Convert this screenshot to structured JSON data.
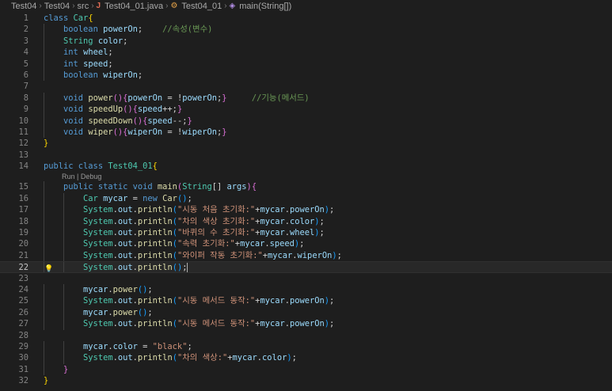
{
  "breadcrumb": {
    "items": [
      "Test04",
      "Test04",
      "src",
      "Test04_01.java",
      "Test04_01",
      "main(String[])"
    ],
    "icons": [
      "java-file-icon",
      "class-icon",
      "method-icon"
    ]
  },
  "editor": {
    "current_line": 22,
    "codelens": "Run | Debug",
    "lines": [
      {
        "n": "1",
        "tokens": [
          [
            "kw",
            "class "
          ],
          [
            "ty",
            "Car"
          ],
          [
            "br1",
            "{"
          ]
        ]
      },
      {
        "n": "2",
        "tokens": [
          [
            "pl",
            "    "
          ],
          [
            "kw",
            "boolean "
          ],
          [
            "va",
            "powerOn"
          ],
          [
            "pl",
            ";    "
          ],
          [
            "cm",
            "//속성(변수)"
          ]
        ]
      },
      {
        "n": "3",
        "tokens": [
          [
            "pl",
            "    "
          ],
          [
            "ty",
            "String "
          ],
          [
            "va",
            "color"
          ],
          [
            "pl",
            ";"
          ]
        ]
      },
      {
        "n": "4",
        "tokens": [
          [
            "pl",
            "    "
          ],
          [
            "kw",
            "int "
          ],
          [
            "va",
            "wheel"
          ],
          [
            "pl",
            ";"
          ]
        ]
      },
      {
        "n": "5",
        "tokens": [
          [
            "pl",
            "    "
          ],
          [
            "kw",
            "int "
          ],
          [
            "va",
            "speed"
          ],
          [
            "pl",
            ";"
          ]
        ]
      },
      {
        "n": "6",
        "tokens": [
          [
            "pl",
            "    "
          ],
          [
            "kw",
            "boolean "
          ],
          [
            "va",
            "wiperOn"
          ],
          [
            "pl",
            ";"
          ]
        ]
      },
      {
        "n": "7",
        "tokens": []
      },
      {
        "n": "8",
        "tokens": [
          [
            "pl",
            "    "
          ],
          [
            "kw",
            "void "
          ],
          [
            "fn",
            "power"
          ],
          [
            "br2",
            "()"
          ],
          [
            "br2",
            "{"
          ],
          [
            "va",
            "powerOn"
          ],
          [
            "pl",
            " = !"
          ],
          [
            "va",
            "powerOn"
          ],
          [
            "pl",
            ";"
          ],
          [
            "br2",
            "}"
          ],
          [
            "pl",
            "     "
          ],
          [
            "cm",
            "//기능(메서드)"
          ]
        ]
      },
      {
        "n": "9",
        "tokens": [
          [
            "pl",
            "    "
          ],
          [
            "kw",
            "void "
          ],
          [
            "fn",
            "speedUp"
          ],
          [
            "br2",
            "()"
          ],
          [
            "br2",
            "{"
          ],
          [
            "va",
            "speed"
          ],
          [
            "pl",
            "++;"
          ],
          [
            "br2",
            "}"
          ]
        ]
      },
      {
        "n": "10",
        "tokens": [
          [
            "pl",
            "    "
          ],
          [
            "kw",
            "void "
          ],
          [
            "fn",
            "speedDown"
          ],
          [
            "br2",
            "()"
          ],
          [
            "br2",
            "{"
          ],
          [
            "va",
            "speed"
          ],
          [
            "pl",
            "--;"
          ],
          [
            "br2",
            "}"
          ]
        ]
      },
      {
        "n": "11",
        "tokens": [
          [
            "pl",
            "    "
          ],
          [
            "kw",
            "void "
          ],
          [
            "fn",
            "wiper"
          ],
          [
            "br2",
            "()"
          ],
          [
            "br2",
            "{"
          ],
          [
            "va",
            "wiperOn"
          ],
          [
            "pl",
            " = !"
          ],
          [
            "va",
            "wiperOn"
          ],
          [
            "pl",
            ";"
          ],
          [
            "br2",
            "}"
          ]
        ]
      },
      {
        "n": "12",
        "tokens": [
          [
            "br1",
            "}"
          ]
        ]
      },
      {
        "n": "13",
        "tokens": []
      },
      {
        "n": "14",
        "tokens": [
          [
            "kw",
            "public class "
          ],
          [
            "ty",
            "Test04_01"
          ],
          [
            "br1",
            "{"
          ]
        ]
      },
      {
        "n": "15",
        "lens": true,
        "tokens": [
          [
            "pl",
            "    "
          ],
          [
            "kw",
            "public static void "
          ],
          [
            "fn",
            "main"
          ],
          [
            "br2",
            "("
          ],
          [
            "ty",
            "String"
          ],
          [
            "pl",
            "[] "
          ],
          [
            "va",
            "args"
          ],
          [
            "br2",
            ")"
          ],
          [
            "br2",
            "{"
          ]
        ]
      },
      {
        "n": "16",
        "tokens": [
          [
            "pl",
            "        "
          ],
          [
            "ty",
            "Car "
          ],
          [
            "va",
            "mycar"
          ],
          [
            "pl",
            " = "
          ],
          [
            "kw",
            "new "
          ],
          [
            "fn",
            "Car"
          ],
          [
            "br3",
            "()"
          ],
          [
            "pl",
            ";"
          ]
        ]
      },
      {
        "n": "17",
        "tokens": [
          [
            "pl",
            "        "
          ],
          [
            "ty",
            "System"
          ],
          [
            "pl",
            "."
          ],
          [
            "va",
            "out"
          ],
          [
            "pl",
            "."
          ],
          [
            "fn",
            "println"
          ],
          [
            "br3",
            "("
          ],
          [
            "st",
            "\"시동 처음 초기화:\""
          ],
          [
            "pl",
            "+"
          ],
          [
            "va",
            "mycar"
          ],
          [
            "pl",
            "."
          ],
          [
            "va",
            "powerOn"
          ],
          [
            "br3",
            ")"
          ],
          [
            "pl",
            ";"
          ]
        ]
      },
      {
        "n": "18",
        "tokens": [
          [
            "pl",
            "        "
          ],
          [
            "ty",
            "System"
          ],
          [
            "pl",
            "."
          ],
          [
            "va",
            "out"
          ],
          [
            "pl",
            "."
          ],
          [
            "fn",
            "println"
          ],
          [
            "br3",
            "("
          ],
          [
            "st",
            "\"차의 색상 초기화:\""
          ],
          [
            "pl",
            "+"
          ],
          [
            "va",
            "mycar"
          ],
          [
            "pl",
            "."
          ],
          [
            "va",
            "color"
          ],
          [
            "br3",
            ")"
          ],
          [
            "pl",
            ";"
          ]
        ]
      },
      {
        "n": "19",
        "tokens": [
          [
            "pl",
            "        "
          ],
          [
            "ty",
            "System"
          ],
          [
            "pl",
            "."
          ],
          [
            "va",
            "out"
          ],
          [
            "pl",
            "."
          ],
          [
            "fn",
            "println"
          ],
          [
            "br3",
            "("
          ],
          [
            "st",
            "\"바퀴의 수 초기화:\""
          ],
          [
            "pl",
            "+"
          ],
          [
            "va",
            "mycar"
          ],
          [
            "pl",
            "."
          ],
          [
            "va",
            "wheel"
          ],
          [
            "br3",
            ")"
          ],
          [
            "pl",
            ";"
          ]
        ]
      },
      {
        "n": "20",
        "tokens": [
          [
            "pl",
            "        "
          ],
          [
            "ty",
            "System"
          ],
          [
            "pl",
            "."
          ],
          [
            "va",
            "out"
          ],
          [
            "pl",
            "."
          ],
          [
            "fn",
            "println"
          ],
          [
            "br3",
            "("
          ],
          [
            "st",
            "\"속력 초기화:\""
          ],
          [
            "pl",
            "+"
          ],
          [
            "va",
            "mycar"
          ],
          [
            "pl",
            "."
          ],
          [
            "va",
            "speed"
          ],
          [
            "br3",
            ")"
          ],
          [
            "pl",
            ";"
          ]
        ]
      },
      {
        "n": "21",
        "tokens": [
          [
            "pl",
            "        "
          ],
          [
            "ty",
            "System"
          ],
          [
            "pl",
            "."
          ],
          [
            "va",
            "out"
          ],
          [
            "pl",
            "."
          ],
          [
            "fn",
            "println"
          ],
          [
            "br3",
            "("
          ],
          [
            "st",
            "\"와이퍼 작동 초기화:\""
          ],
          [
            "pl",
            "+"
          ],
          [
            "va",
            "mycar"
          ],
          [
            "pl",
            "."
          ],
          [
            "va",
            "wiperOn"
          ],
          [
            "br3",
            ")"
          ],
          [
            "pl",
            ";"
          ]
        ]
      },
      {
        "n": "22",
        "bulb": true,
        "caret": true,
        "tokens": [
          [
            "pl",
            "        "
          ],
          [
            "ty",
            "System"
          ],
          [
            "pl",
            "."
          ],
          [
            "va",
            "out"
          ],
          [
            "pl",
            "."
          ],
          [
            "fn",
            "println"
          ],
          [
            "br3",
            "()"
          ],
          [
            "pl",
            ";"
          ]
        ]
      },
      {
        "n": "23",
        "tokens": []
      },
      {
        "n": "24",
        "tokens": [
          [
            "pl",
            "        "
          ],
          [
            "va",
            "mycar"
          ],
          [
            "pl",
            "."
          ],
          [
            "fn",
            "power"
          ],
          [
            "br3",
            "()"
          ],
          [
            "pl",
            ";"
          ]
        ]
      },
      {
        "n": "25",
        "tokens": [
          [
            "pl",
            "        "
          ],
          [
            "ty",
            "System"
          ],
          [
            "pl",
            "."
          ],
          [
            "va",
            "out"
          ],
          [
            "pl",
            "."
          ],
          [
            "fn",
            "println"
          ],
          [
            "br3",
            "("
          ],
          [
            "st",
            "\"시동 메서드 동작:\""
          ],
          [
            "pl",
            "+"
          ],
          [
            "va",
            "mycar"
          ],
          [
            "pl",
            "."
          ],
          [
            "va",
            "powerOn"
          ],
          [
            "br3",
            ")"
          ],
          [
            "pl",
            ";"
          ]
        ]
      },
      {
        "n": "26",
        "tokens": [
          [
            "pl",
            "        "
          ],
          [
            "va",
            "mycar"
          ],
          [
            "pl",
            "."
          ],
          [
            "fn",
            "power"
          ],
          [
            "br3",
            "()"
          ],
          [
            "pl",
            ";"
          ]
        ]
      },
      {
        "n": "27",
        "tokens": [
          [
            "pl",
            "        "
          ],
          [
            "ty",
            "System"
          ],
          [
            "pl",
            "."
          ],
          [
            "va",
            "out"
          ],
          [
            "pl",
            "."
          ],
          [
            "fn",
            "println"
          ],
          [
            "br3",
            "("
          ],
          [
            "st",
            "\"시동 메서드 동작:\""
          ],
          [
            "pl",
            "+"
          ],
          [
            "va",
            "mycar"
          ],
          [
            "pl",
            "."
          ],
          [
            "va",
            "powerOn"
          ],
          [
            "br3",
            ")"
          ],
          [
            "pl",
            ";"
          ]
        ]
      },
      {
        "n": "28",
        "tokens": []
      },
      {
        "n": "29",
        "tokens": [
          [
            "pl",
            "        "
          ],
          [
            "va",
            "mycar"
          ],
          [
            "pl",
            "."
          ],
          [
            "va",
            "color"
          ],
          [
            "pl",
            " = "
          ],
          [
            "st",
            "\"black\""
          ],
          [
            "pl",
            ";"
          ]
        ]
      },
      {
        "n": "30",
        "tokens": [
          [
            "pl",
            "        "
          ],
          [
            "ty",
            "System"
          ],
          [
            "pl",
            "."
          ],
          [
            "va",
            "out"
          ],
          [
            "pl",
            "."
          ],
          [
            "fn",
            "println"
          ],
          [
            "br3",
            "("
          ],
          [
            "st",
            "\"차의 색상:\""
          ],
          [
            "pl",
            "+"
          ],
          [
            "va",
            "mycar"
          ],
          [
            "pl",
            "."
          ],
          [
            "va",
            "color"
          ],
          [
            "br3",
            ")"
          ],
          [
            "pl",
            ";"
          ]
        ]
      },
      {
        "n": "31",
        "tokens": [
          [
            "pl",
            "    "
          ],
          [
            "br2",
            "}"
          ]
        ]
      },
      {
        "n": "32",
        "tokens": [
          [
            "br1",
            "}"
          ]
        ]
      }
    ]
  }
}
